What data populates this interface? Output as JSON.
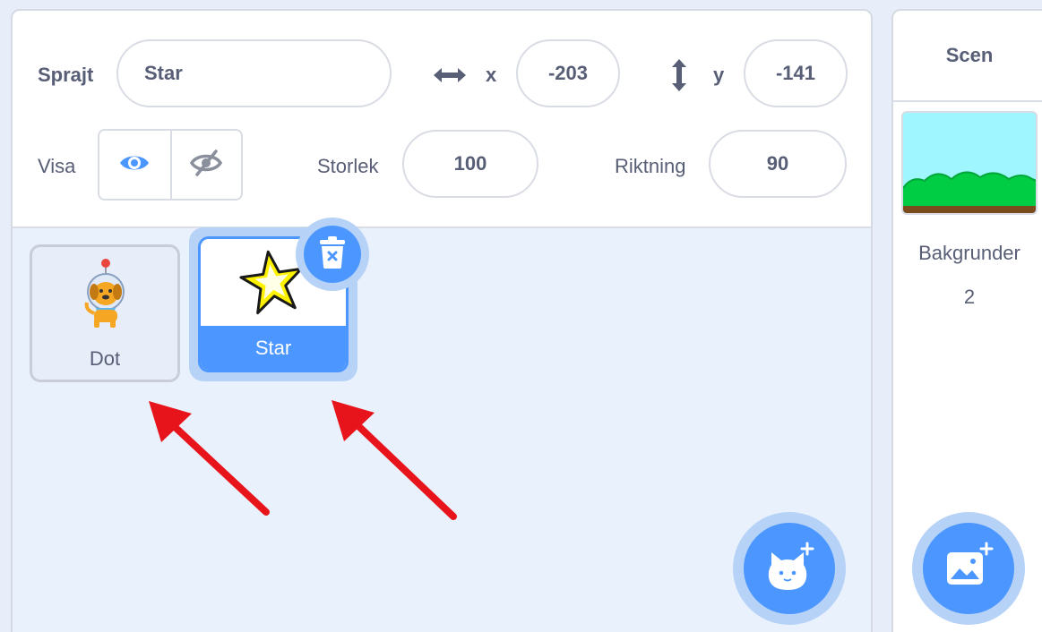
{
  "sprite_info": {
    "sprite_label": "Sprajt",
    "sprite_name": "Star",
    "x_label": "x",
    "x_value": "-203",
    "y_label": "y",
    "y_value": "-141",
    "show_label": "Visa",
    "size_label": "Storlek",
    "size_value": "100",
    "direction_label": "Riktning",
    "direction_value": "90",
    "visible": true
  },
  "sprites": [
    {
      "name": "Dot",
      "selected": false
    },
    {
      "name": "Star",
      "selected": true
    }
  ],
  "stage": {
    "title": "Scen",
    "backdrops_label": "Bakgrunder",
    "backdrops_count": "2"
  },
  "colors": {
    "accent": "#4c97ff",
    "annotation_arrow": "#e8141c"
  },
  "icons": [
    "horizontal-arrow-icon",
    "vertical-arrow-icon",
    "eye-icon",
    "eye-hidden-icon",
    "trash-icon",
    "add-sprite-icon",
    "add-backdrop-icon"
  ]
}
